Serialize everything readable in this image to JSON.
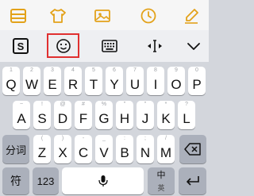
{
  "toolbar": {
    "icons": [
      "menu-icon",
      "tshirt-icon",
      "image-icon",
      "clock-icon",
      "pen-icon"
    ]
  },
  "candidate_bar": {
    "logo_letter": "S",
    "icons": [
      "sogou-logo-icon",
      "emoji-icon",
      "keyboard-icon",
      "cursor-move-icon",
      "chevron-down-icon"
    ]
  },
  "keyboard": {
    "row1": [
      {
        "key": "Q",
        "hint": "1"
      },
      {
        "key": "W",
        "hint": "2"
      },
      {
        "key": "E",
        "hint": "3"
      },
      {
        "key": "R",
        "hint": "4"
      },
      {
        "key": "T",
        "hint": "5"
      },
      {
        "key": "Y",
        "hint": "6"
      },
      {
        "key": "U",
        "hint": "7"
      },
      {
        "key": "I",
        "hint": "8"
      },
      {
        "key": "O",
        "hint": "9"
      },
      {
        "key": "P",
        "hint": "0"
      }
    ],
    "row2": [
      {
        "key": "A",
        "hint": "~"
      },
      {
        "key": "S",
        "hint": "!"
      },
      {
        "key": "D",
        "hint": "@"
      },
      {
        "key": "F",
        "hint": "#"
      },
      {
        "key": "G",
        "hint": "%"
      },
      {
        "key": "H",
        "hint": "\""
      },
      {
        "key": "J",
        "hint": "\""
      },
      {
        "key": "K",
        "hint": "*"
      },
      {
        "key": "L",
        "hint": "?"
      }
    ],
    "row3": [
      {
        "key": "Z",
        "hint": "("
      },
      {
        "key": "X",
        "hint": ")"
      },
      {
        "key": "C",
        "hint": "-"
      },
      {
        "key": "V",
        "hint": "_"
      },
      {
        "key": "B",
        "hint": ":"
      },
      {
        "key": "N",
        "hint": ";"
      },
      {
        "key": "M",
        "hint": "/"
      }
    ],
    "fenci_label": "分词",
    "symbol_label": "符",
    "number_label": "123",
    "lang_zh_label": "中",
    "lang_en_label": "英"
  },
  "colors": {
    "accent": "#e3a21a",
    "highlight": "#e03030",
    "key": "#ffffff",
    "func_key": "#abb0bb",
    "keyboard_bg": "#d3d6dc"
  }
}
